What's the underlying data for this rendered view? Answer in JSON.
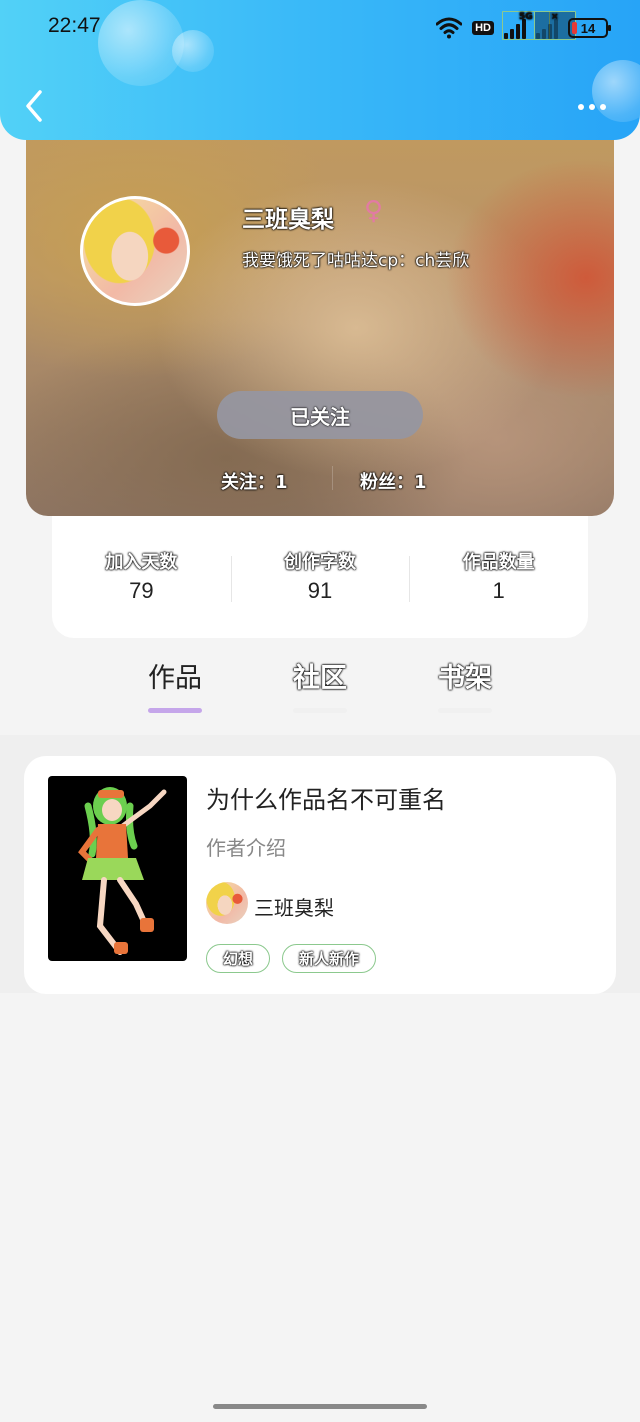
{
  "status_bar": {
    "time": "22:47",
    "network_badge": "HD",
    "signal_tag_1": "5G",
    "signal_tag_2": "×",
    "battery": "14",
    "icons": [
      "wifi-icon",
      "hd-icon",
      "signal-5g-icon",
      "signal-icon",
      "battery-icon"
    ]
  },
  "header": {
    "back_icon": "chevron-left-icon",
    "more_icon": "more-dots-icon"
  },
  "profile": {
    "name": "三班臭梨",
    "gender_symbol": "♀",
    "bio": "我要饿死了咕咕达cp：ch芸欣",
    "follow_button": "已关注",
    "following": "关注：1",
    "followers": "粉丝：1"
  },
  "stats": [
    {
      "label": "加入天数",
      "value": "79"
    },
    {
      "label": "创作字数",
      "value": "91"
    },
    {
      "label": "作品数量",
      "value": "1"
    }
  ],
  "tabs": [
    {
      "label": "作品",
      "active": true
    },
    {
      "label": "社区",
      "active": false
    },
    {
      "label": "书架",
      "active": false
    }
  ],
  "works": [
    {
      "title": "为什么作品名不可重名",
      "description": "作者介绍",
      "author": "三班臭梨",
      "tags": [
        "幻想",
        "新人新作"
      ]
    }
  ],
  "colors": {
    "header_gradient_start": "#52d1f7",
    "header_gradient_end": "#27a4f7",
    "active_tab_underline": "#c5a6ea",
    "tag_border": "#8cc98e",
    "gender_color": "#e27aa3",
    "follow_button_bg": "#9696a0"
  }
}
